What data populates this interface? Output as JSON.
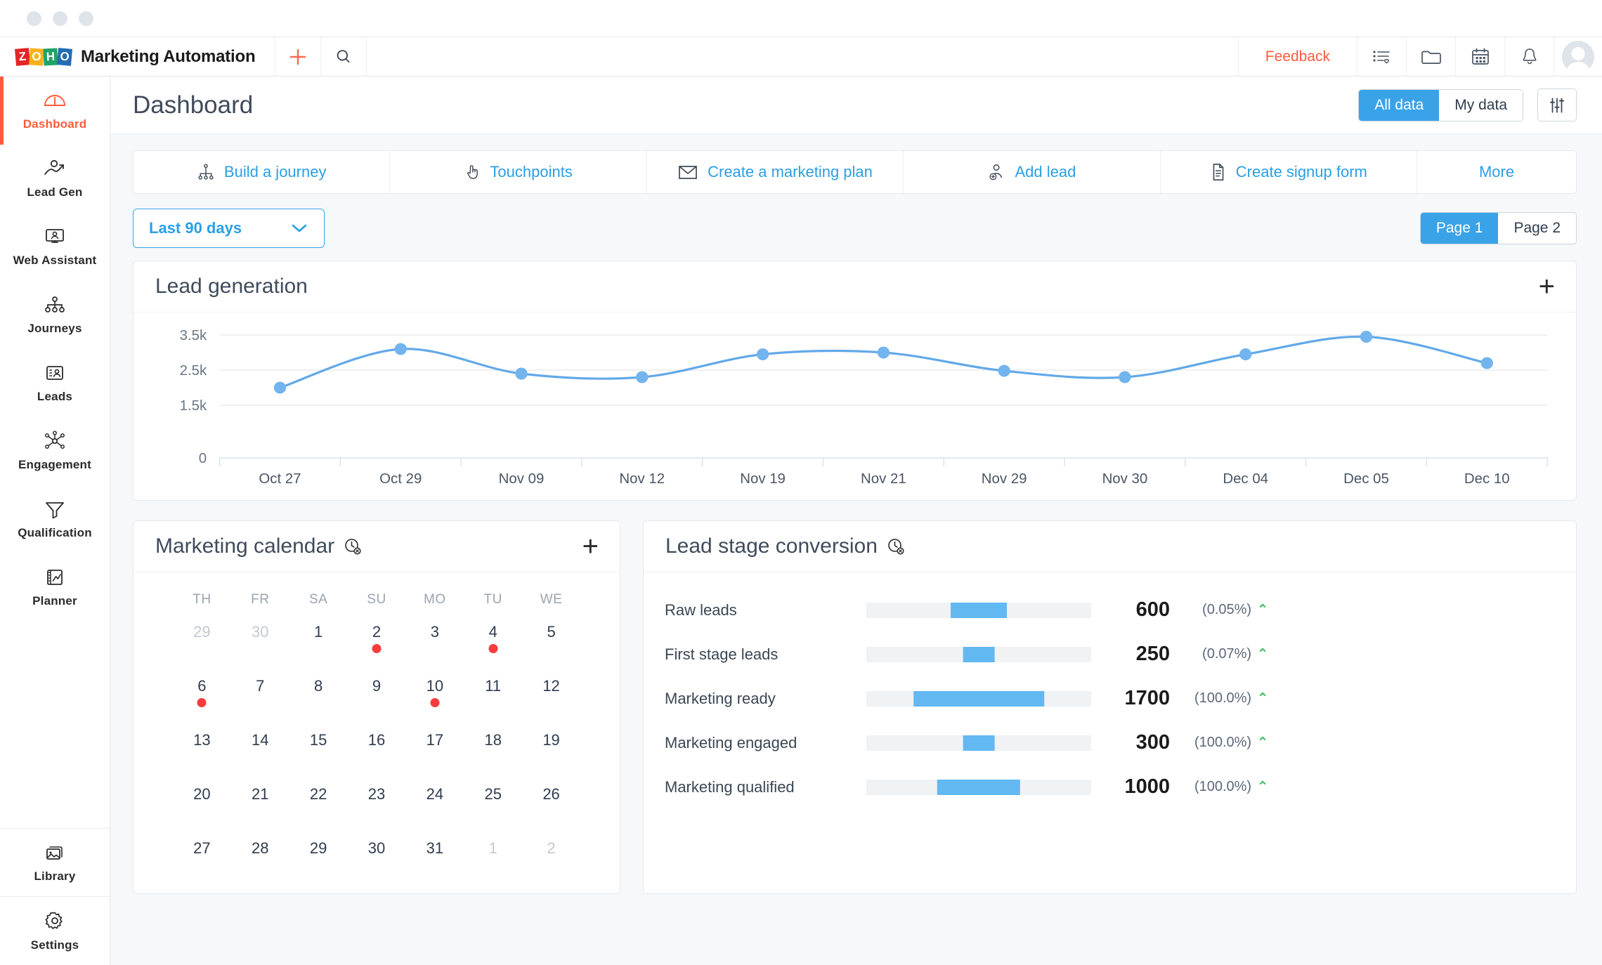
{
  "window": {
    "dots": 3
  },
  "topbar": {
    "logo_letters": [
      "Z",
      "O",
      "H",
      "O"
    ],
    "product_name": "Marketing Automation",
    "add_icon": "plus-icon",
    "search_icon": "search-icon",
    "feedback_label": "Feedback",
    "icons": [
      {
        "name": "list-favorite-icon"
      },
      {
        "name": "folder-icon"
      },
      {
        "name": "calendar-icon"
      },
      {
        "name": "bell-icon"
      }
    ],
    "avatar": "user-avatar"
  },
  "sidebar": {
    "items": [
      {
        "label": "Dashboard",
        "icon": "gauge-icon",
        "active": true
      },
      {
        "label": "Lead Gen",
        "icon": "lead-growth-icon",
        "active": false
      },
      {
        "label": "Web Assistant",
        "icon": "monitor-person-icon",
        "active": false
      },
      {
        "label": "Journeys",
        "icon": "hierarchy-icon",
        "active": false
      },
      {
        "label": "Leads",
        "icon": "contact-card-icon",
        "active": false
      },
      {
        "label": "Engagement",
        "icon": "network-node-icon",
        "active": false
      },
      {
        "label": "Qualification",
        "icon": "funnel-icon",
        "active": false
      },
      {
        "label": "Planner",
        "icon": "planner-board-icon",
        "active": false
      }
    ],
    "bottom_items": [
      {
        "label": "Library",
        "icon": "images-icon"
      },
      {
        "label": "Settings",
        "icon": "gear-icon"
      }
    ]
  },
  "page": {
    "title": "Dashboard",
    "data_scope": {
      "options": [
        "All data",
        "My data"
      ],
      "selected": "All data"
    },
    "filter_icon": "sliders-icon"
  },
  "quick_actions": [
    {
      "label": "Build a journey",
      "icon": "journey-icon"
    },
    {
      "label": "Touchpoints",
      "icon": "touch-icon"
    },
    {
      "label": "Create a marketing plan",
      "icon": "envelope-icon"
    },
    {
      "label": "Add lead",
      "icon": "add-person-icon"
    },
    {
      "label": "Create signup form",
      "icon": "document-icon"
    },
    {
      "label": "More",
      "icon": ""
    }
  ],
  "filters": {
    "date_range": {
      "value": "Last 90 days",
      "chevron": "chevron-down-icon"
    },
    "pages": {
      "options": [
        "Page 1",
        "Page 2"
      ],
      "selected": "Page 1"
    }
  },
  "cards": {
    "lead_generation": {
      "title": "Lead generation",
      "add_icon": "plus-icon"
    },
    "marketing_calendar": {
      "title": "Marketing calendar",
      "info_icon": "clock-disabled-icon",
      "add_icon": "plus-icon"
    },
    "lead_stage_conversion": {
      "title": "Lead stage conversion",
      "info_icon": "clock-disabled-icon"
    }
  },
  "chart_data": {
    "type": "line",
    "title": "Lead generation",
    "xlabel": "",
    "ylabel": "",
    "categories": [
      "Oct 27",
      "Oct 29",
      "Nov 09",
      "Nov 12",
      "Nov 19",
      "Nov 21",
      "Nov 29",
      "Nov 30",
      "Dec 04",
      "Dec 05",
      "Dec 10"
    ],
    "values": [
      2000,
      3100,
      2400,
      2300,
      2950,
      3000,
      2480,
      2300,
      2950,
      3450,
      2700
    ],
    "ytick_labels": [
      "0",
      "1.5k",
      "2.5k",
      "3.5k"
    ],
    "ytick_values": [
      0,
      1500,
      2500,
      3500
    ],
    "ylim": [
      0,
      3900
    ],
    "grid": true,
    "legend": false,
    "line_color": "#62a9e8",
    "point_color": "#72b4ee"
  },
  "calendar": {
    "dow": [
      "TH",
      "FR",
      "SA",
      "SU",
      "MO",
      "TU",
      "WE"
    ],
    "weeks": [
      [
        {
          "d": "29",
          "dim": true,
          "event": false
        },
        {
          "d": "30",
          "dim": true,
          "event": false
        },
        {
          "d": "1",
          "dim": false,
          "event": false
        },
        {
          "d": "2",
          "dim": false,
          "event": true
        },
        {
          "d": "3",
          "dim": false,
          "event": false
        },
        {
          "d": "4",
          "dim": false,
          "event": true
        },
        {
          "d": "5",
          "dim": false,
          "event": false
        }
      ],
      [
        {
          "d": "6",
          "dim": false,
          "event": true
        },
        {
          "d": "7",
          "dim": false,
          "event": false
        },
        {
          "d": "8",
          "dim": false,
          "event": false
        },
        {
          "d": "9",
          "dim": false,
          "event": false
        },
        {
          "d": "10",
          "dim": false,
          "event": true
        },
        {
          "d": "11",
          "dim": false,
          "event": false
        },
        {
          "d": "12",
          "dim": false,
          "event": false
        }
      ],
      [
        {
          "d": "13",
          "dim": false,
          "event": false
        },
        {
          "d": "14",
          "dim": false,
          "event": false
        },
        {
          "d": "15",
          "dim": false,
          "event": false
        },
        {
          "d": "16",
          "dim": false,
          "event": false
        },
        {
          "d": "17",
          "dim": false,
          "event": false
        },
        {
          "d": "18",
          "dim": false,
          "event": false
        },
        {
          "d": "19",
          "dim": false,
          "event": false
        }
      ],
      [
        {
          "d": "20",
          "dim": false,
          "event": false
        },
        {
          "d": "21",
          "dim": false,
          "event": false
        },
        {
          "d": "22",
          "dim": false,
          "event": false
        },
        {
          "d": "23",
          "dim": false,
          "event": false
        },
        {
          "d": "24",
          "dim": false,
          "event": false
        },
        {
          "d": "25",
          "dim": false,
          "event": false
        },
        {
          "d": "26",
          "dim": false,
          "event": false
        }
      ],
      [
        {
          "d": "27",
          "dim": false,
          "event": false
        },
        {
          "d": "28",
          "dim": false,
          "event": false
        },
        {
          "d": "29",
          "dim": false,
          "event": false
        },
        {
          "d": "30",
          "dim": false,
          "event": false
        },
        {
          "d": "31",
          "dim": false,
          "event": false
        },
        {
          "d": "1",
          "dim": true,
          "event": false
        },
        {
          "d": "2",
          "dim": true,
          "event": false
        }
      ]
    ]
  },
  "conversion": {
    "rows": [
      {
        "label": "Raw leads",
        "value": "600",
        "pct": "(0.05%)",
        "bar_pct": 25,
        "trend": "up"
      },
      {
        "label": "First stage leads",
        "value": "250",
        "pct": "(0.07%)",
        "bar_pct": 14,
        "trend": "up"
      },
      {
        "label": "Marketing ready",
        "value": "1700",
        "pct": "(100.0%)",
        "bar_pct": 58,
        "trend": "up"
      },
      {
        "label": "Marketing engaged",
        "value": "300",
        "pct": "(100.0%)",
        "bar_pct": 14,
        "trend": "up"
      },
      {
        "label": "Marketing qualified",
        "value": "1000",
        "pct": "(100.0%)",
        "bar_pct": 37,
        "trend": "up"
      }
    ]
  },
  "colors": {
    "accent_orange": "#ff5b3c",
    "accent_blue": "#3aa3e8",
    "link_blue": "#2b9fe4",
    "event_red": "#f73c3c",
    "trend_green": "#4ec26a",
    "bar_blue": "#62b9f2",
    "page_bg": "#f6f8fa"
  }
}
